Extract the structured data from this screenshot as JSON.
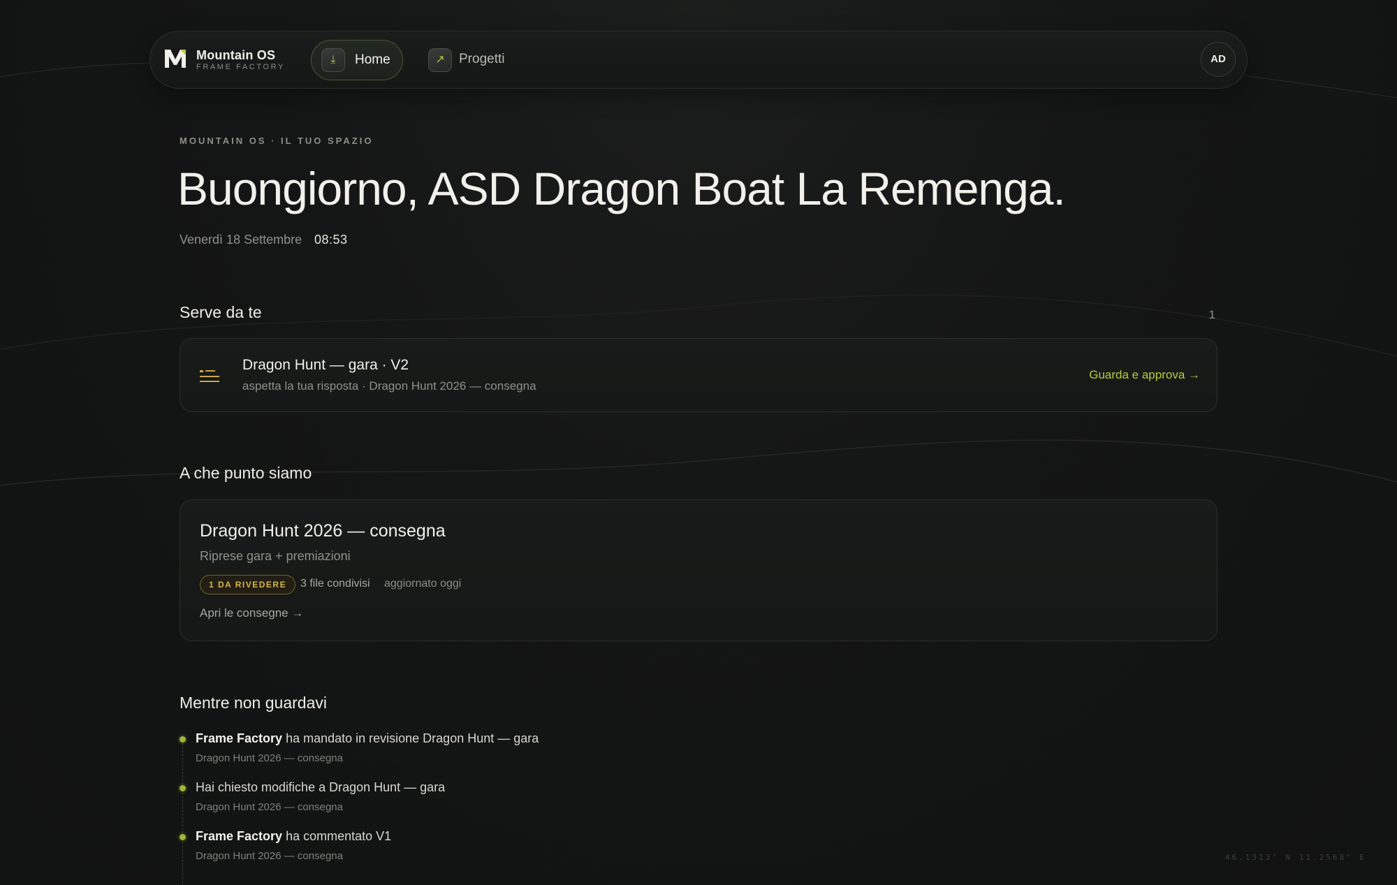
{
  "nav": {
    "brand_name": "Mountain OS",
    "brand_sub": "FRAME FACTORY",
    "home_label": "Home",
    "projects_label": "Progetti",
    "avatar_initials": "AD",
    "accent_color": "#b7cd3f"
  },
  "header": {
    "eyebrow": "MOUNTAIN OS · IL TUO SPAZIO",
    "greeting": "Buongiorno, ASD Dragon Boat La Remenga.",
    "date": "Venerdì 18 Settembre",
    "time": "08:53"
  },
  "requests": {
    "title": "Serve da te",
    "count": "1",
    "items": [
      {
        "title": "Dragon Hunt — gara · V2",
        "subtitle": "aspetta la tua risposta · Dragon Hunt 2026 — consegna",
        "cta": "Guarda e approva →",
        "icon": "list-icon"
      }
    ]
  },
  "progress": {
    "title": "A che punto siamo",
    "project": {
      "title": "Dragon Hunt 2026 — consegna",
      "description": "Riprese gara + premiazioni",
      "badge": "1 DA RIVEDERE",
      "files": "3 file condivisi",
      "updated": "aggiornato oggi",
      "link": "Apri le consegne →"
    }
  },
  "activity": {
    "title": "Mentre non guardavi",
    "items": [
      {
        "actor": "Frame Factory",
        "text": " ha mandato in revisione Dragon Hunt — gara",
        "sub": "Dragon Hunt 2026 — consegna"
      },
      {
        "actor": "",
        "text": "Hai chiesto modifiche a Dragon Hunt — gara",
        "sub": "Dragon Hunt 2026 — consegna"
      },
      {
        "actor": "Frame Factory",
        "text": " ha commentato V1",
        "sub": "Dragon Hunt 2026 — consegna"
      }
    ]
  },
  "footer": {
    "coords": "46.1313° N    11.2568° E"
  }
}
